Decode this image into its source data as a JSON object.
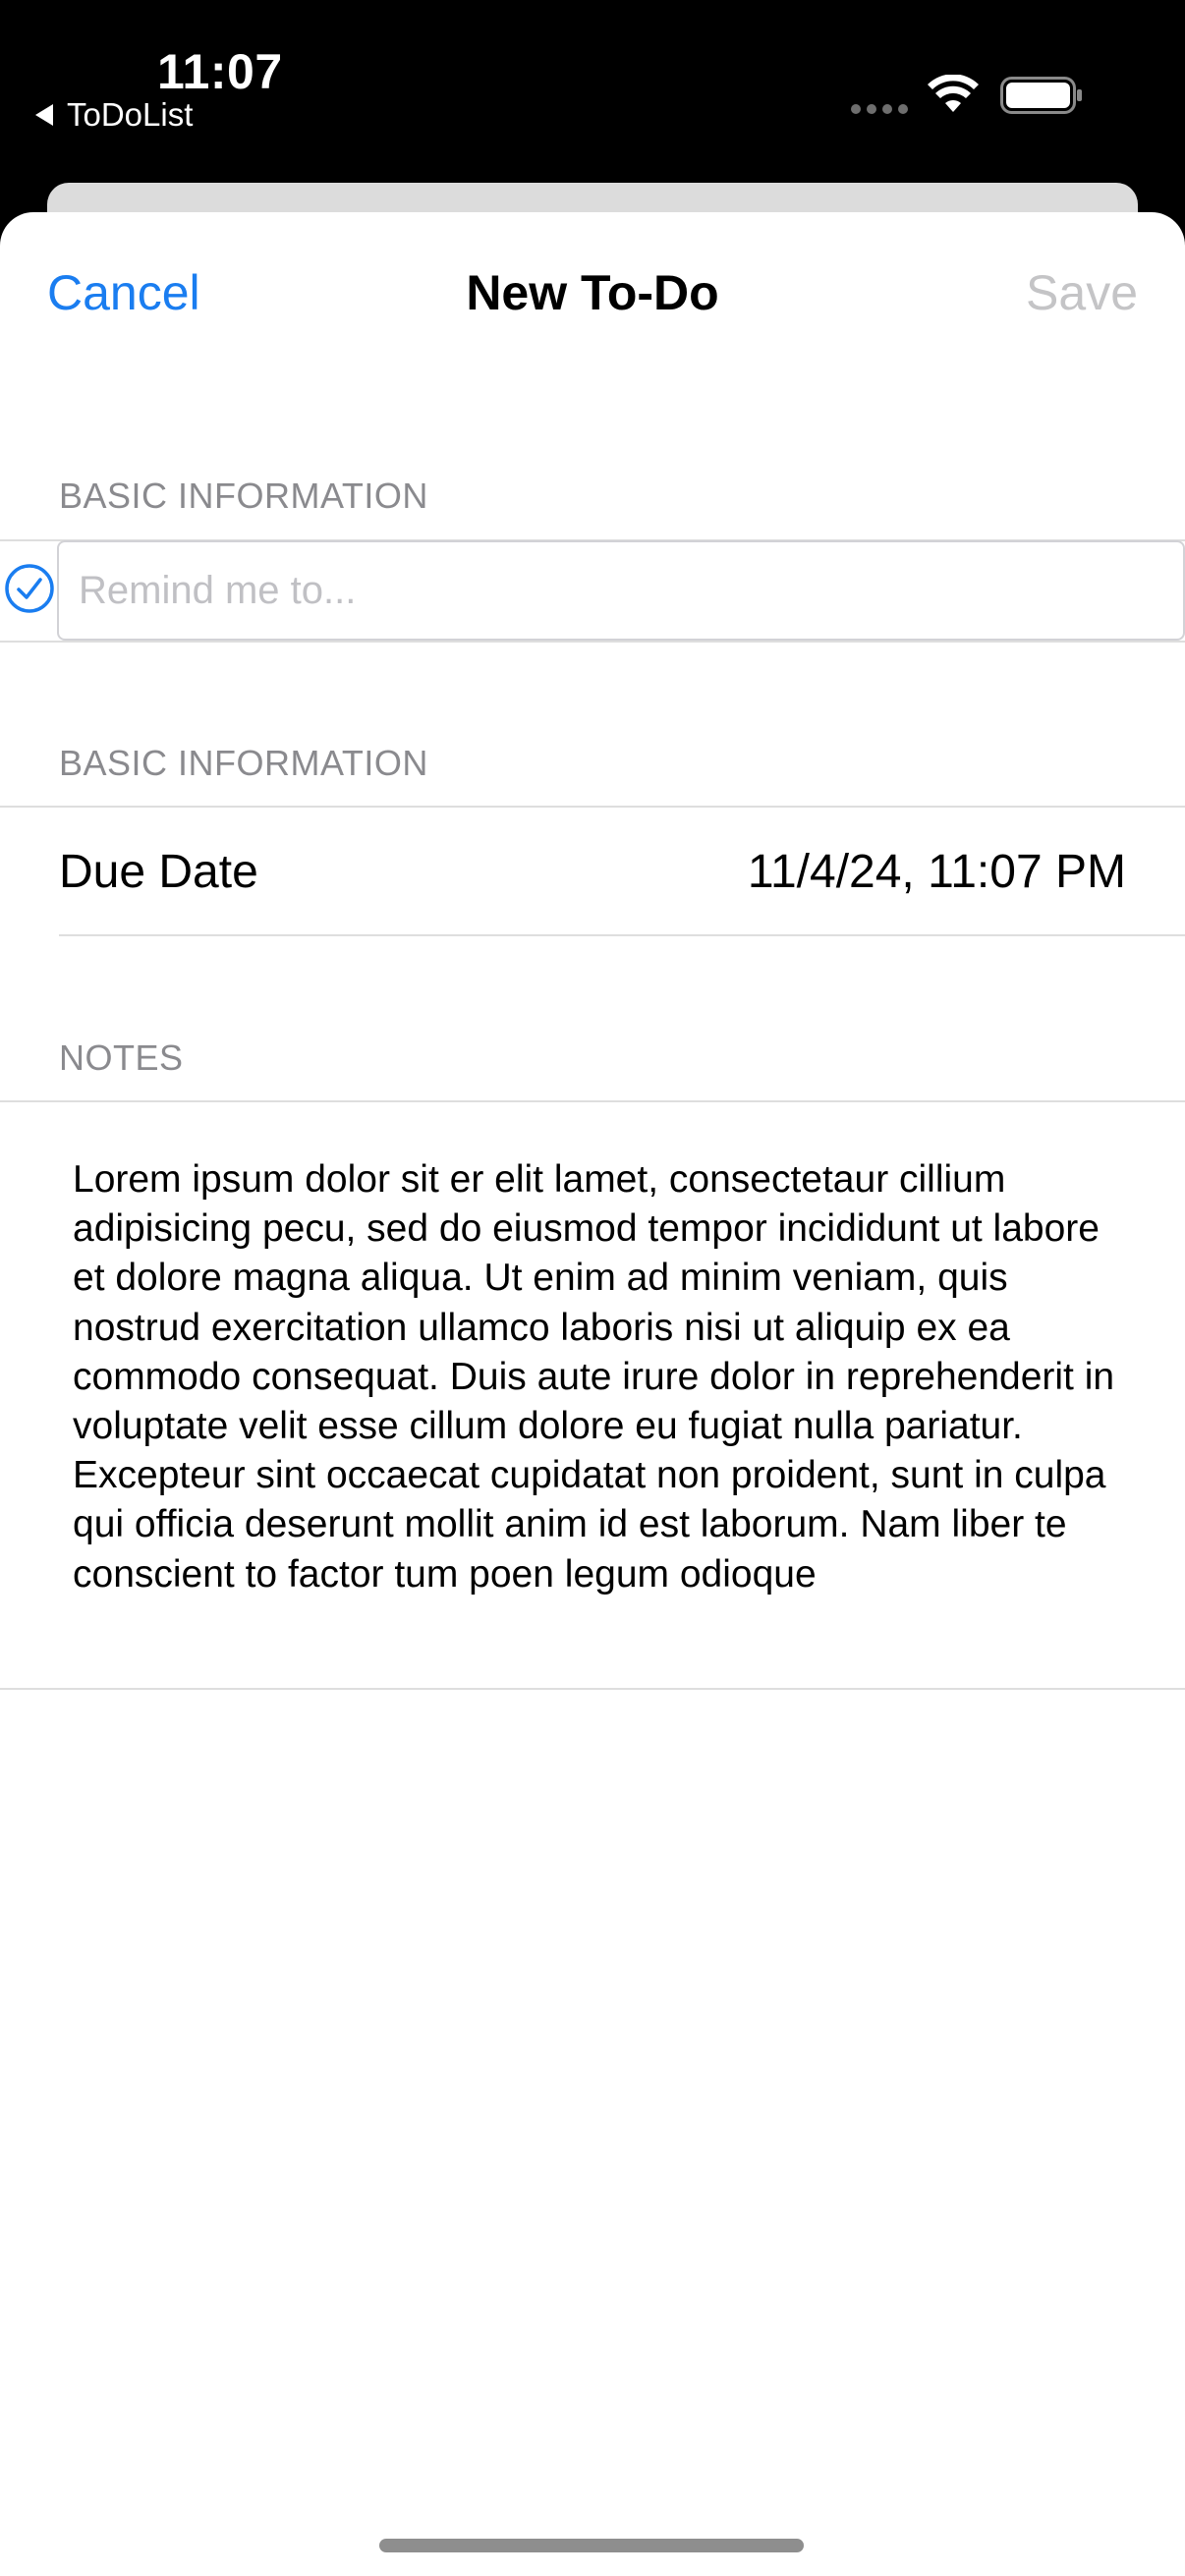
{
  "status_bar": {
    "time": "11:07",
    "back_app": "ToDoList"
  },
  "nav": {
    "cancel_label": "Cancel",
    "title": "New To-Do",
    "save_label": "Save"
  },
  "sections": {
    "basic_header_1": "BASIC INFORMATION",
    "basic_header_2": "BASIC INFORMATION",
    "notes_header": "NOTES"
  },
  "reminder": {
    "placeholder": "Remind me to...",
    "value": ""
  },
  "due_date": {
    "label": "Due Date",
    "value": "11/4/24, 11:07 PM"
  },
  "notes": {
    "text": "Lorem ipsum dolor sit er elit lamet, consectetaur cillium adipisicing pecu, sed do eiusmod tempor incididunt ut labore et dolore magna aliqua. Ut enim ad minim veniam, quis nostrud exercitation ullamco laboris nisi ut aliquip ex ea commodo consequat. Duis aute irure dolor in reprehenderit in voluptate velit esse cillum dolore eu fugiat nulla pariatur. Excepteur sint occaecat cupidatat non proident, sunt in culpa qui officia deserunt mollit anim id est laborum. Nam liber te conscient to factor tum poen legum odioque"
  },
  "colors": {
    "accent": "#1a7df0",
    "disabled": "#c4c4c6",
    "section_header": "#8a8a8e"
  },
  "icons": {
    "check": "checkmark-circle-icon",
    "wifi": "wifi-icon",
    "battery": "battery-icon",
    "back": "back-triangle-icon"
  }
}
